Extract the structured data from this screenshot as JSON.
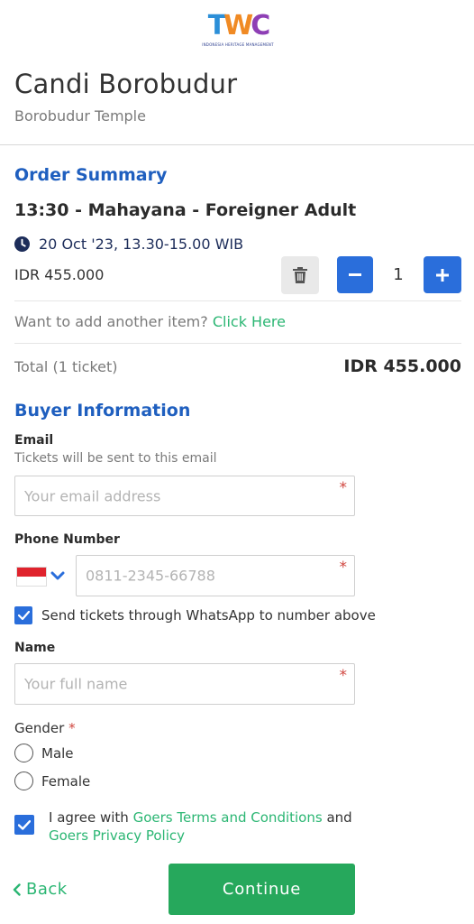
{
  "brand": {
    "logo_letters": [
      "T",
      "W",
      "C"
    ],
    "logo_colors": [
      "#2c8fd8",
      "#f08a24",
      "#8e3fb5"
    ],
    "logo_subtitle": "INDONESIA HERITAGE MANAGEMENT"
  },
  "header": {
    "title": "Candi Borobudur",
    "subtitle": "Borobudur Temple"
  },
  "order": {
    "section_title": "Order Summary",
    "item_title": "13:30 - Mahayana - Foreigner Adult",
    "date": "20 Oct '23, 13.30-15.00 WIB",
    "price": "IDR 455.000",
    "quantity": "1",
    "add_prompt": "Want to add another item?",
    "add_link": "Click Here",
    "total_label": "Total (1 ticket)",
    "total_value": "IDR 455.000"
  },
  "buyer": {
    "section_title": "Buyer Information",
    "email_label": "Email",
    "email_hint": "Tickets will be sent to this email",
    "email_placeholder": "Your email address",
    "phone_label": "Phone Number",
    "phone_placeholder": "0811-2345-66788",
    "whatsapp_label": "Send tickets through WhatsApp to number above",
    "whatsapp_checked": true,
    "name_label": "Name",
    "name_placeholder": "Your full name",
    "required_mark": "*",
    "gender_label": "Gender",
    "gender_options": [
      "Male",
      "Female"
    ],
    "agree_prefix": "I agree with",
    "agree_terms_link": "Goers Terms and Conditions",
    "agree_and": "and",
    "agree_privacy_link": "Goers Privacy Policy",
    "agree_checked": true
  },
  "footer": {
    "back_label": "Back",
    "continue_label": "Continue"
  },
  "colors": {
    "primary_blue": "#2a6edb",
    "heading_blue": "#1f5fbf",
    "green": "#26a85c",
    "required_red": "#d0463f"
  }
}
